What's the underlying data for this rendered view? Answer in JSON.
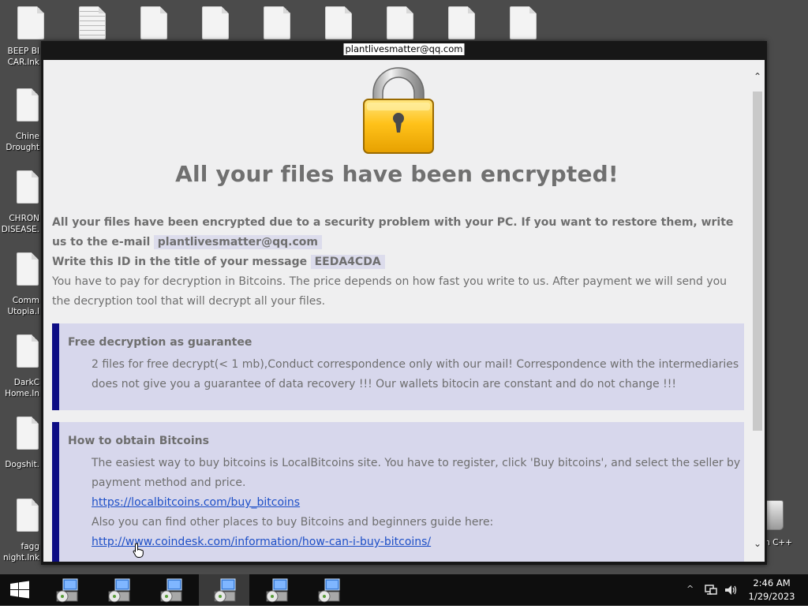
{
  "desktop": {
    "top_icon_count": 9,
    "left_icons": [
      {
        "label_line1": "BEEP BI",
        "label_line2": "CAR.lnk"
      },
      {
        "label_line1": "Chine",
        "label_line2": "Drought"
      },
      {
        "label_line1": "CHRON",
        "label_line2": "DISEASE."
      },
      {
        "label_line1": "Comm",
        "label_line2": "Utopia.l"
      },
      {
        "label_line1": "DarkC",
        "label_line2": "Home.ln"
      },
      {
        "label_line1": "Dogshit.",
        "label_line2": ""
      },
      {
        "label_line1": "fagg",
        "label_line2": "night.lnk"
      }
    ],
    "recycle_bin_label": "n C++"
  },
  "window": {
    "title": "plantlivesmatter@qq.com",
    "scroll_up_glyph": "⌃",
    "scroll_down_glyph": "⌄"
  },
  "message": {
    "headline": "All your files have been encrypted!",
    "intro_bold": "All your files have been encrypted due to a security problem with your PC. If you want to restore them, write us to the e-mail",
    "email": "plantlivesmatter@qq.com",
    "id_prompt": "Write this ID in the title of your message",
    "id_value": "EEDA4CDA",
    "payment_text": "You have to pay for decryption in Bitcoins. The price depends on how fast you write to us. After payment we will send you the decryption tool that will decrypt all your files.",
    "free_heading": "Free decryption as guarantee",
    "free_body": "2 files for free decrypt(< 1 mb),Conduct correspondence only with our mail! Correspondence with the intermediaries does not give you a guarantee of data recovery !!! Our wallets bitocin are constant and do not change !!!",
    "obtain_heading": "How to obtain Bitcoins",
    "obtain_body": "The easiest way to buy bitcoins is LocalBitcoins site. You have to register, click 'Buy bitcoins', and select the seller by payment method and price.",
    "link1": "https://localbitcoins.com/buy_bitcoins",
    "also_text": "Also you can find other places to buy Bitcoins and beginners guide here:",
    "link2": "http://www.coindesk.com/information/how-can-i-buy-bitcoins/"
  },
  "taskbar": {
    "tasks": 6,
    "active_task_index": 3,
    "tray_chevron": "^",
    "clock_time": "2:46 AM",
    "clock_date": "1/29/2023"
  },
  "colors": {
    "desktop_bg": "#4b4b4b",
    "content_bg": "#efeff0",
    "box_bg": "#d7d7ec",
    "box_accent": "#0d0d85",
    "text_gray": "#6e6e6e",
    "link_blue": "#1d4fc7"
  }
}
